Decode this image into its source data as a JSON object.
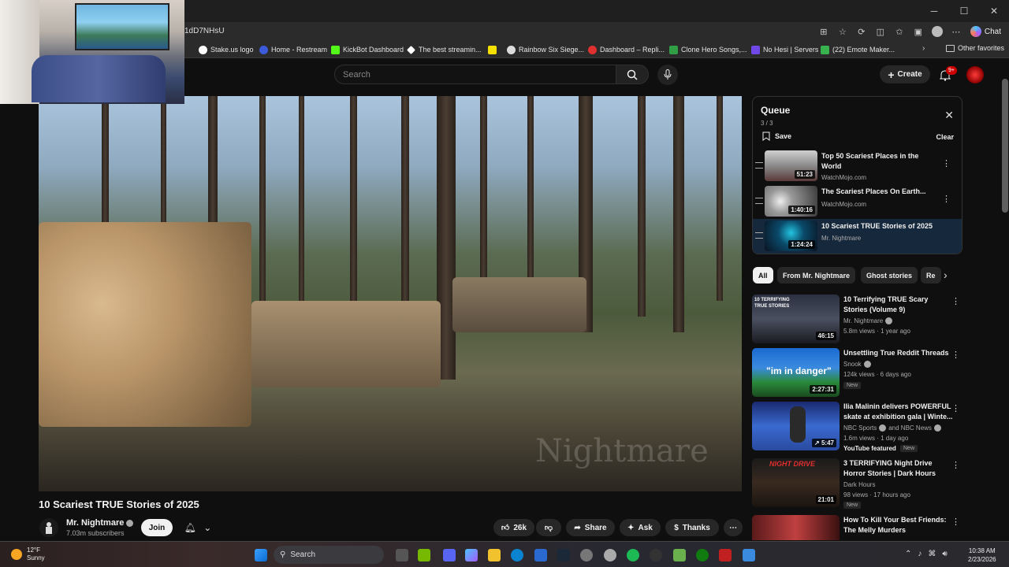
{
  "browser": {
    "url": "1dD7NHsU",
    "chat_label": "Chat",
    "window_controls": [
      "─",
      "☐",
      "✕"
    ],
    "bookmarks": [
      {
        "label": "Stake.us logo",
        "color": "#ffffff"
      },
      {
        "label": "Home - Restream",
        "color": "#3b5bdb"
      },
      {
        "label": "KickBot Dashboard",
        "color": "#53fc18"
      },
      {
        "label": "The best streamin...",
        "color": "#ffffff"
      },
      {
        "label": "",
        "color": "#f5e000"
      },
      {
        "label": "Rainbow Six Siege...",
        "color": "#dddddd"
      },
      {
        "label": "Dashboard – Repli...",
        "color": "#e03131"
      },
      {
        "label": "Clone Hero Songs,...",
        "color": "#2f9e44"
      },
      {
        "label": "No Hesi | Servers",
        "color": "#7048e8"
      },
      {
        "label": "(22) Emote Maker...",
        "color": "#37b24d"
      }
    ],
    "other_favorites": "Other favorites"
  },
  "masthead": {
    "search_placeholder": "Search",
    "create_label": "Create",
    "notification_count": "9+"
  },
  "video": {
    "title": "10 Scariest TRUE Stories of 2025",
    "watermark": "Nightmare",
    "channel": "Mr. Nightmare",
    "subscribers": "7.03m subscribers",
    "join_label": "Join",
    "likes": "26k",
    "share_label": "Share",
    "ask_label": "Ask",
    "thanks_label": "Thanks"
  },
  "queue": {
    "title": "Queue",
    "count": "3 / 3",
    "save_label": "Save",
    "clear_label": "Clear",
    "items": [
      {
        "title": "Top 50 Scariest Places in the World",
        "channel": "WatchMojo.com",
        "duration": "51:23",
        "thumb": "#8a8a8a"
      },
      {
        "title": "The Scariest Places On Earth...",
        "channel": "WatchMojo.com",
        "duration": "1:40:16",
        "thumb": "#6a6a6a"
      },
      {
        "title": "10 Scariest TRUE Stories of 2025",
        "channel": "Mr. Nightmare",
        "duration": "1:24:24",
        "thumb": "#1a2a40"
      }
    ]
  },
  "chips": [
    "All",
    "From Mr. Nightmare",
    "Ghost stories",
    "Re"
  ],
  "recommendations": [
    {
      "title": "10 Terrifying TRUE Scary Stories (Volume 9)",
      "channel": "Mr. Nightmare",
      "views": "5.8m views · 1 year ago",
      "duration": "46:15",
      "thumb_text": "10 TERRIFYING TRUE STORIES",
      "badge": "",
      "extra": ""
    },
    {
      "title": "Unsettling True Reddit Threads",
      "channel": "Snook",
      "views": "124k views · 6 days ago",
      "duration": "2:27:31",
      "thumb_text": "\"im in danger\"",
      "badge": "New",
      "extra": ""
    },
    {
      "title": "Ilia Malinin delivers POWERFUL skate at exhibition gala | Winte...",
      "channel": "NBC Sports",
      "channel2": "and NBC News",
      "views": "1.6m views · 1 day ago",
      "duration": "5:47",
      "thumb_text": "",
      "badge": "New",
      "extra": "YouTube featured"
    },
    {
      "title": "3 TERRIFYING Night Drive Horror Stories | Dark Hours",
      "channel": "Dark Hours",
      "views": "98 views · 17 hours ago",
      "duration": "21:01",
      "thumb_text": "NIGHT DRIVE",
      "badge": "New",
      "extra": ""
    },
    {
      "title": "How To Kill Your Best Friends: The Melly Murders",
      "channel": "",
      "views": "",
      "duration": "",
      "thumb_text": "",
      "badge": "",
      "extra": ""
    }
  ],
  "taskbar": {
    "weather_temp": "12°F",
    "weather_cond": "Sunny",
    "search_label": "Search",
    "time": "10:38 AM",
    "date": "2/23/2026"
  }
}
